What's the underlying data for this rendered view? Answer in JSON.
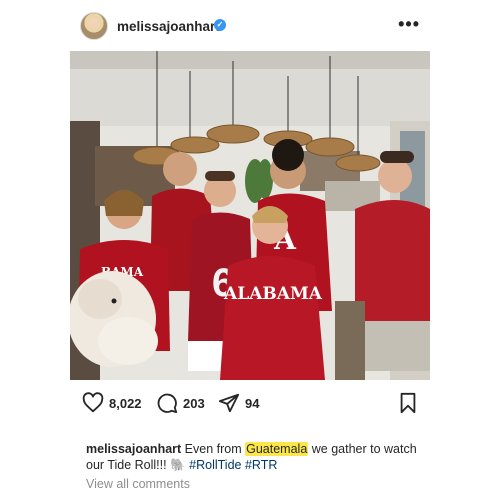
{
  "post": {
    "username": "melissajoanhart",
    "verified_icon": "verified-badge-icon",
    "more_icon": "more-options-icon",
    "photo_shirt_texts": {
      "alabama": "ALABAMA",
      "number": "6",
      "letter": "A",
      "bama": "BAMA"
    }
  },
  "actions": {
    "likes": "8,022",
    "comments": "203",
    "shares": "94"
  },
  "caption": {
    "username": "melissajoanhart",
    "text_before": "Even from",
    "highlight": "Guatemala",
    "text_after": "we gather to watch our Tide Roll!!!",
    "emoji": "🐘",
    "hashtag1": "#RollTide",
    "hashtag2": "#RTR"
  },
  "view_all_comments": "View all comments",
  "colors": {
    "crimson": "#a8141e",
    "highlight": "#fbe74a",
    "hashtag": "#00376b"
  }
}
